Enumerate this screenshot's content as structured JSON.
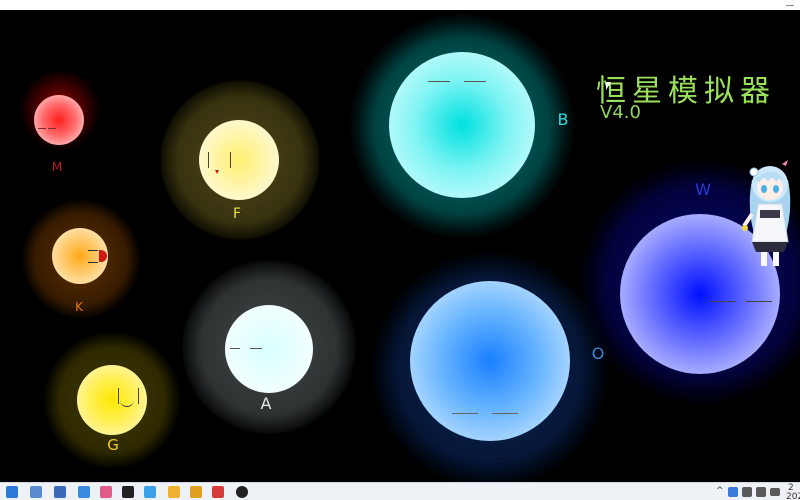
{
  "app": {
    "title": "恒星模拟器",
    "version": "V4.0"
  },
  "stars": [
    {
      "id": "m",
      "label": "M",
      "label_color": "#c01818",
      "core": "#ff2424",
      "halo": "#8a0000"
    },
    {
      "id": "f",
      "label": "F",
      "label_color": "#e8e040",
      "core": "#fff4a0",
      "halo": "#7a7420"
    },
    {
      "id": "k",
      "label": "K",
      "label_color": "#e07a10",
      "core": "#ffb030",
      "halo": "#7a3c00"
    },
    {
      "id": "g",
      "label": "G",
      "label_color": "#f0d020",
      "core": "#ffe820",
      "halo": "#6e6000"
    },
    {
      "id": "a",
      "label": "A",
      "label_color": "#e8e8e8",
      "core": "#e8ffff",
      "halo": "#5a6464"
    },
    {
      "id": "b",
      "label": "B",
      "label_color": "#30d8e0",
      "core": "#00e8e8",
      "halo": "#005a5a"
    },
    {
      "id": "o",
      "label": "O",
      "label_color": "#3a8ad8",
      "core": "#1a8aff",
      "halo": "#0a2a5a"
    },
    {
      "id": "w",
      "label": "W",
      "label_color": "#2a3ad0",
      "core": "#0a10ff",
      "halo": "#05055a"
    }
  ],
  "taskbar": {
    "icons": [
      "start-icon",
      "file-icon",
      "settings-icon",
      "snowflake-icon",
      "photos-icon",
      "video-icon",
      "meeting-icon",
      "folder-icon",
      "game-icon",
      "app-icon",
      "browser-icon"
    ],
    "tray_chevron": "^",
    "clock_line1": "2",
    "clock_line2": "202"
  }
}
